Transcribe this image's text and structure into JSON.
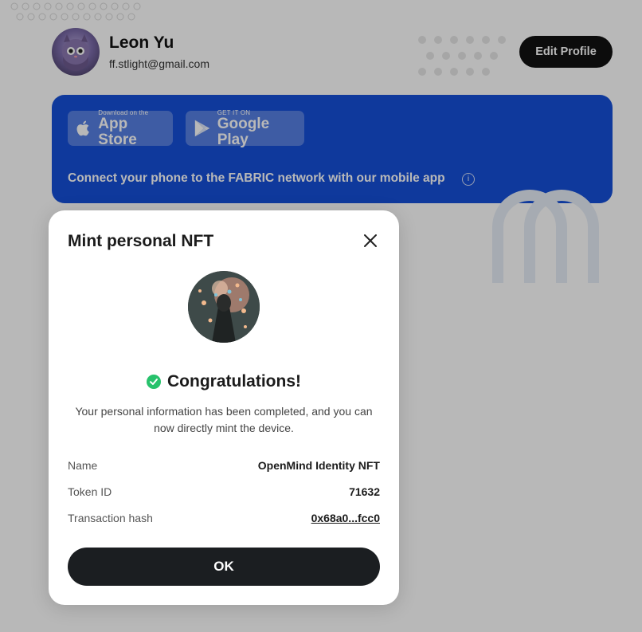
{
  "profile": {
    "name": "Leon Yu",
    "email": "ff.stlight@gmail.com",
    "edit_button": "Edit Profile"
  },
  "banner": {
    "app_store_small": "Download on the",
    "app_store_big": "App Store",
    "google_play_small": "GET IT ON",
    "google_play_big": "Google Play",
    "text": "Connect your phone to the FABRIC network with our mobile app",
    "info_icon": "i",
    "color": "#1550d9"
  },
  "modal": {
    "title": "Mint personal NFT",
    "congrats": "Congratulations!",
    "description": "Your personal information has been completed, and you can now directly mint the device.",
    "rows": [
      {
        "label": "Name",
        "value": "OpenMind Identity NFT"
      },
      {
        "label": "Token ID",
        "value": "71632"
      },
      {
        "label": "Transaction hash",
        "value": "0x68a0...fcc0"
      }
    ],
    "ok_button": "OK",
    "success_color": "#27c26c"
  },
  "icons": {
    "close": "close-icon",
    "check": "check-circle-icon",
    "apple": "apple-icon",
    "play": "google-play-icon",
    "info": "info-icon"
  }
}
